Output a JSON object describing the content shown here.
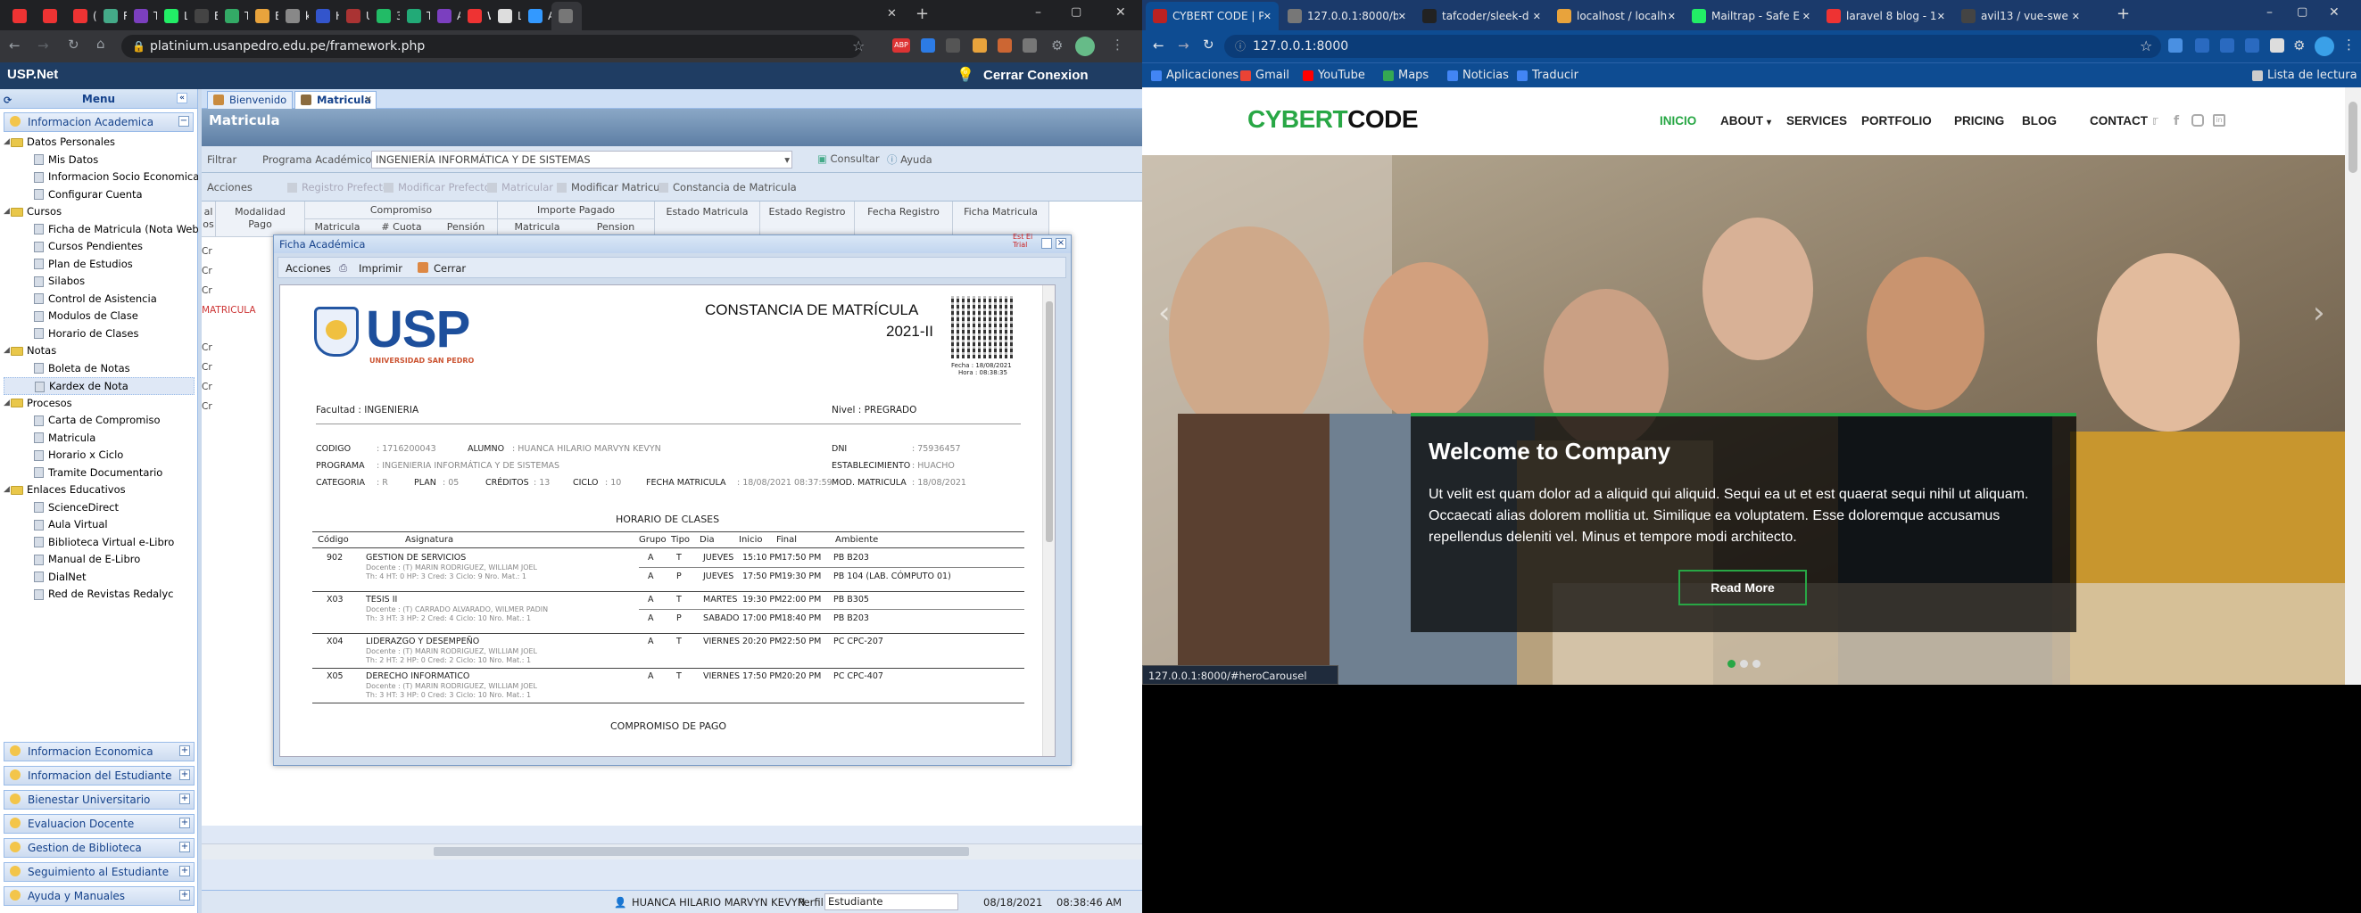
{
  "left_browser": {
    "tabs": [
      "",
      "",
      "(4)",
      "Ra",
      "Ta",
      "La",
      "Em",
      "Tra",
      "Bo",
      "key",
      "Ho",
      "Ud",
      "3 §",
      "Tra",
      "Ab",
      "Wi",
      "La",
      "Ac",
      ""
    ],
    "url": "platinium.usanpedro.edu.pe/framework.php"
  },
  "app": {
    "title": "USP.Net",
    "logout": "Cerrar Conexion",
    "menu_title": "Menu",
    "accordion_top": "Informacion Academica",
    "tree": [
      {
        "t": "Datos Personales",
        "lvl": 0,
        "folder": true
      },
      {
        "t": "Mis Datos",
        "lvl": 1
      },
      {
        "t": "Informacion Socio Economica",
        "lvl": 1
      },
      {
        "t": "Configurar Cuenta",
        "lvl": 1
      },
      {
        "t": "Cursos",
        "lvl": 0,
        "folder": true
      },
      {
        "t": "Ficha de Matricula (Nota Web)",
        "lvl": 1
      },
      {
        "t": "Cursos Pendientes",
        "lvl": 1
      },
      {
        "t": "Plan de Estudios",
        "lvl": 1
      },
      {
        "t": "Silabos",
        "lvl": 1
      },
      {
        "t": "Control de Asistencia",
        "lvl": 1
      },
      {
        "t": "Modulos de Clase",
        "lvl": 1
      },
      {
        "t": "Horario de Clases",
        "lvl": 1
      },
      {
        "t": "Notas",
        "lvl": 0,
        "folder": true
      },
      {
        "t": "Boleta de Notas",
        "lvl": 1
      },
      {
        "t": "Kardex de Nota",
        "lvl": 1,
        "sel": true
      },
      {
        "t": "Procesos",
        "lvl": 0,
        "folder": true
      },
      {
        "t": "Carta de Compromiso",
        "lvl": 1
      },
      {
        "t": "Matricula",
        "lvl": 1
      },
      {
        "t": "Horario x Ciclo",
        "lvl": 1
      },
      {
        "t": "Tramite Documentario",
        "lvl": 1
      },
      {
        "t": "Enlaces Educativos",
        "lvl": 0,
        "folder": true
      },
      {
        "t": "ScienceDirect",
        "lvl": 1
      },
      {
        "t": "Aula Virtual",
        "lvl": 1
      },
      {
        "t": "Biblioteca Virtual e-Libro",
        "lvl": 1
      },
      {
        "t": "Manual de E-Libro",
        "lvl": 1
      },
      {
        "t": "DialNet",
        "lvl": 1
      },
      {
        "t": "Red de Revistas Redalyc",
        "lvl": 1
      }
    ],
    "accordions_bottom": [
      "Informacion Economica",
      "Informacion del Estudiante",
      "Bienestar Universitario",
      "Evaluacion Docente",
      "Gestion de Biblioteca",
      "Seguimiento al Estudiante",
      "Ayuda y Manuales"
    ],
    "tabs": [
      "Bienvenido",
      "Matricula"
    ],
    "panel_title": "Matricula",
    "filter": {
      "label": "Filtrar",
      "prog_label": "Programa Académico",
      "prog_value": "INGENIERÍA INFORMÁTICA Y DE SISTEMAS",
      "consultar": "Consultar",
      "ayuda": "Ayuda"
    },
    "actions": [
      "Acciones",
      "Registro Prefecto",
      "Modificar Prefecto",
      "Matricular",
      "Modificar Matricula",
      "Constancia de Matricula"
    ],
    "grid_headers": {
      "al": "al",
      "os": "os",
      "modalidad": "Modalidad",
      "pago": "Pago",
      "compromiso": "Compromiso",
      "matricula": "Matricula",
      "ncuota": "# Cuota",
      "pension": "Pensión",
      "importe": "Importe Pagado",
      "imp_mat": "Matricula",
      "imp_pen": "Pension",
      "estado_mat": "Estado Matricula",
      "estado_reg": "Estado Registro",
      "fecha_reg": "Fecha Registro",
      "ficha": "Ficha Matricula"
    },
    "grid_left_cells": [
      "Cr",
      "Cr",
      "Cr",
      "MATRICULA",
      "Cr",
      "Cr",
      "Cr",
      "Cr"
    ],
    "status": {
      "user": "HUANCA HILARIO MARVYN KEVYN",
      "perfil_label": "Perfil",
      "perfil": "Estudiante",
      "date": "08/18/2021",
      "time": "08:38:46 AM"
    }
  },
  "dialog": {
    "title": "Ficha Académica",
    "toolbar": [
      "Acciones",
      "Imprimir",
      "Cerrar"
    ],
    "sidehint": "Est Ei Trial"
  },
  "doc": {
    "logo": "USP",
    "logo_sub": "UNIVERSIDAD SAN PEDRO",
    "title1": "CONSTANCIA DE MATRÍCULA",
    "title2": "2021-II",
    "fecha": "Fecha : 18/08/2021",
    "hora": "Hora : 08:38:35",
    "facultad": "Facultad : INGENIERIA",
    "nivel": "Nivel : PREGRADO",
    "codigo_l": "CODIGO",
    "codigo": ": 1716200043",
    "alumno_l": "ALUMNO",
    "alumno": ": HUANCA HILARIO MARVYN KEVYN",
    "dni_l": "DNI",
    "dni": ": 75936457",
    "programa_l": "PROGRAMA",
    "programa": ": INGENIERIA INFORMÁTICA Y DE SISTEMAS",
    "est_l": "ESTABLECIMIENTO",
    "est": ": HUACHO",
    "cat_l": "CATEGORIA",
    "cat": ": R",
    "plan_l": "PLAN",
    "plan": ": 05",
    "cred_l": "CRÉDITOS",
    "cred": ": 13",
    "ciclo_l": "CICLO",
    "ciclo": ": 10",
    "fm_l": "FECHA MATRICULA",
    "fm": ": 18/08/2021 08:37:59",
    "mm_l": "MOD. MATRICULA",
    "mm": ": 18/08/2021",
    "horario_title": "HORARIO DE CLASES",
    "cols": [
      "Código",
      "Asignatura",
      "Grupo",
      "Tipo",
      "Dia",
      "Inicio",
      "Final",
      "Ambiente"
    ],
    "rows": [
      {
        "code": "902",
        "name": "GESTION DE SERVICIOS",
        "doc": "Docente : (T) MARIN RODRIGUEZ, WILLIAM JOEL",
        "info": "Th: 4   HT: 0   HP: 3   Cred: 3   Ciclo: 9   Nro. Mat.: 1",
        "lines": [
          [
            "A",
            "T",
            "JUEVES",
            "15:10 PM",
            "17:50 PM",
            "PB B203"
          ],
          [
            "A",
            "P",
            "JUEVES",
            "17:50 PM",
            "19:30 PM",
            "PB 104 (LAB. CÓMPUTO 01)"
          ]
        ]
      },
      {
        "code": "X03",
        "name": "TESIS II",
        "doc": "Docente : (T) CARRADO ALVARADO, WILMER PADIN",
        "info": "Th: 3   HT: 3   HP: 2   Cred: 4   Ciclo: 10   Nro. Mat.: 1",
        "lines": [
          [
            "A",
            "T",
            "MARTES",
            "19:30 PM",
            "22:00 PM",
            "PB B305"
          ],
          [
            "A",
            "P",
            "SABADO",
            "17:00 PM",
            "18:40 PM",
            "PB B203"
          ]
        ]
      },
      {
        "code": "X04",
        "name": "LIDERAZGO Y DESEMPEÑO",
        "doc": "Docente : (T) MARIN RODRIGUEZ, WILLIAM JOEL",
        "info": "Th: 2   HT: 2   HP: 0   Cred: 2   Ciclo: 10   Nro. Mat.: 1",
        "lines": [
          [
            "A",
            "T",
            "VIERNES",
            "20:20 PM",
            "22:50 PM",
            "PC CPC-207"
          ]
        ]
      },
      {
        "code": "X05",
        "name": "DERECHO INFORMATICO",
        "doc": "Docente : (T) MARIN RODRIGUEZ, WILLIAM JOEL",
        "info": "Th: 3   HT: 3   HP: 0   Cred: 3   Ciclo: 10   Nro. Mat.: 1",
        "lines": [
          [
            "A",
            "T",
            "VIERNES",
            "17:50 PM",
            "20:20 PM",
            "PC CPC-407"
          ]
        ]
      }
    ],
    "compromiso": "COMPROMISO DE PAGO"
  },
  "right_browser": {
    "tabs": [
      "CYBERT CODE | P",
      "127.0.0.1:8000/b",
      "tafcoder/sleek-d",
      "localhost / localh",
      "Mailtrap - Safe E",
      "laravel 8 blog - 1",
      "avil13 / vue-swe"
    ],
    "url": "127.0.0.1:8000",
    "bookmarks": [
      "Aplicaciones",
      "Gmail",
      "YouTube",
      "Maps",
      "Noticias",
      "Traducir"
    ],
    "reading_list": "Lista de lectura",
    "status_url": "127.0.0.1:8000/#heroCarousel"
  },
  "site": {
    "logo_a": "CYBERT",
    "logo_b": "CODE",
    "nav": [
      "INICIO",
      "ABOUT",
      "SERVICES",
      "PORTFOLIO",
      "PRICING",
      "BLOG",
      "CONTACT"
    ],
    "hero_title": "Welcome to Company",
    "hero_text": "Ut velit est quam dolor ad a aliquid qui aliquid. Sequi ea ut et est quaerat sequi nihil ut aliquam. Occaecati alias dolorem mollitia ut. Similique ea voluptatem. Esse doloremque accusamus repellendus deleniti vel. Minus et tempore modi architecto.",
    "button": "Read More",
    "accent": "#28a745"
  }
}
